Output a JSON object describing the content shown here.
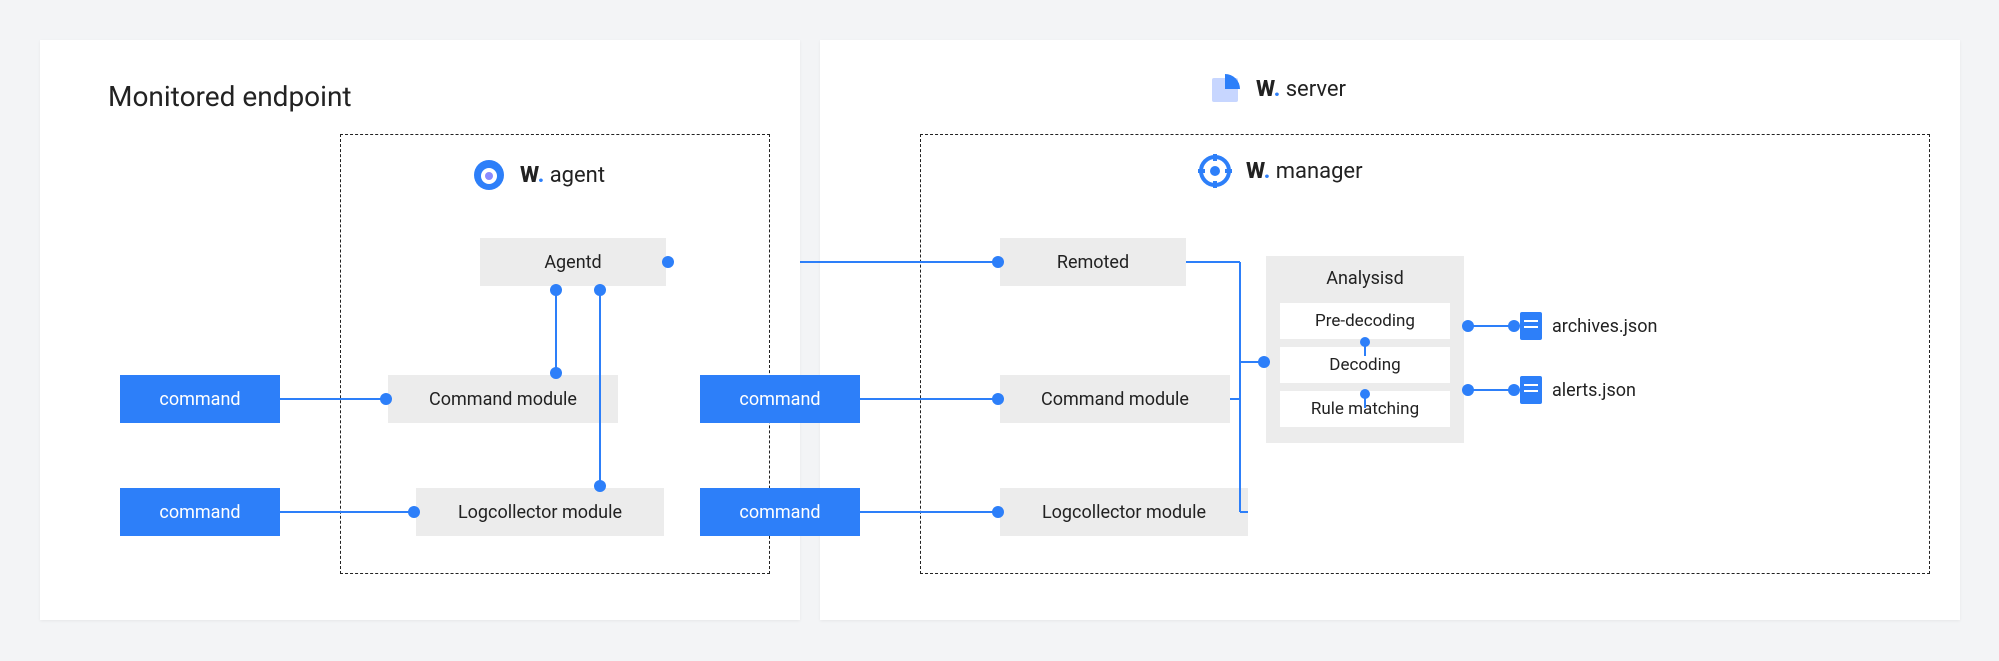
{
  "endpoint": {
    "title": "Monitored endpoint",
    "agent_label": "agent",
    "brand": "W",
    "agentd": "Agentd",
    "command_module": "Command module",
    "logcollector_module": "Logcollector module",
    "command": "command"
  },
  "server": {
    "server_label": "server",
    "manager_label": "manager",
    "brand": "W",
    "remoted": "Remoted",
    "command_module": "Command module",
    "logcollector_module": "Logcollector module",
    "command": "command",
    "analysisd": {
      "title": "Analysisd",
      "pre_decoding": "Pre-decoding",
      "decoding": "Decoding",
      "rule_matching": "Rule matching"
    },
    "files": {
      "archives": "archives.json",
      "alerts": "alerts.json"
    }
  },
  "colors": {
    "accent": "#2d7ff9",
    "node_bg": "#ececec",
    "bg": "#f3f4f6",
    "panel": "#ffffff"
  }
}
